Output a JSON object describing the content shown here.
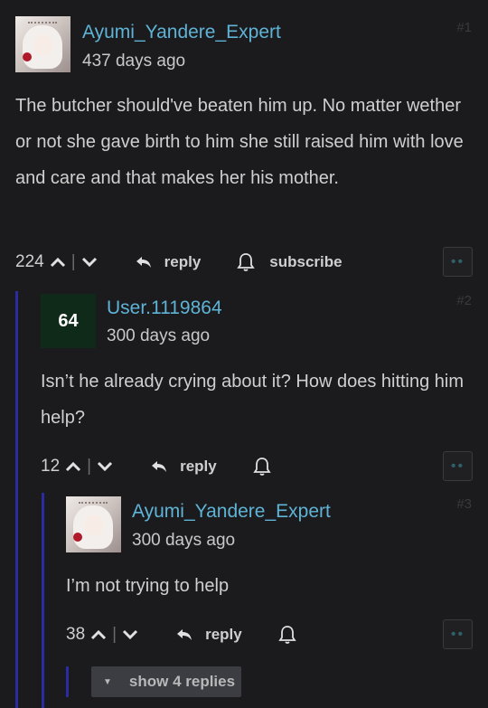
{
  "comments": [
    {
      "username": "Ayumi_Yandere_Expert",
      "time": "437 days ago",
      "number": "#1",
      "text": "The butcher should've beaten him up. No matter wether or not she gave birth to him she still raised him with love and care and that makes her his mother.",
      "votes": "224",
      "reply_label": "reply",
      "subscribe_label": "subscribe"
    },
    {
      "username": "User.1119864",
      "avatar_text": "64",
      "time": "300 days ago",
      "number": "#2",
      "text": "Isn’t he already crying about it? How does hitting him help?",
      "votes": "12",
      "reply_label": "reply"
    },
    {
      "username": "Ayumi_Yandere_Expert",
      "time": "300 days ago",
      "number": "#3",
      "text": "I’m not trying to help",
      "votes": "38",
      "reply_label": "reply"
    }
  ],
  "show_replies_label": "show 4 replies",
  "colors": {
    "background": "#1b1b1d",
    "username": "#5fb3d6",
    "thread_bar": "#2b2ba3",
    "number_avatar_bg": "#0f2a18"
  },
  "icons": {
    "upvote": "chevron-up-icon",
    "downvote": "chevron-down-icon",
    "reply": "reply-arrow-icon",
    "subscribe": "bell-icon",
    "more": "more-dots-icon",
    "expand": "caret-down-icon"
  }
}
